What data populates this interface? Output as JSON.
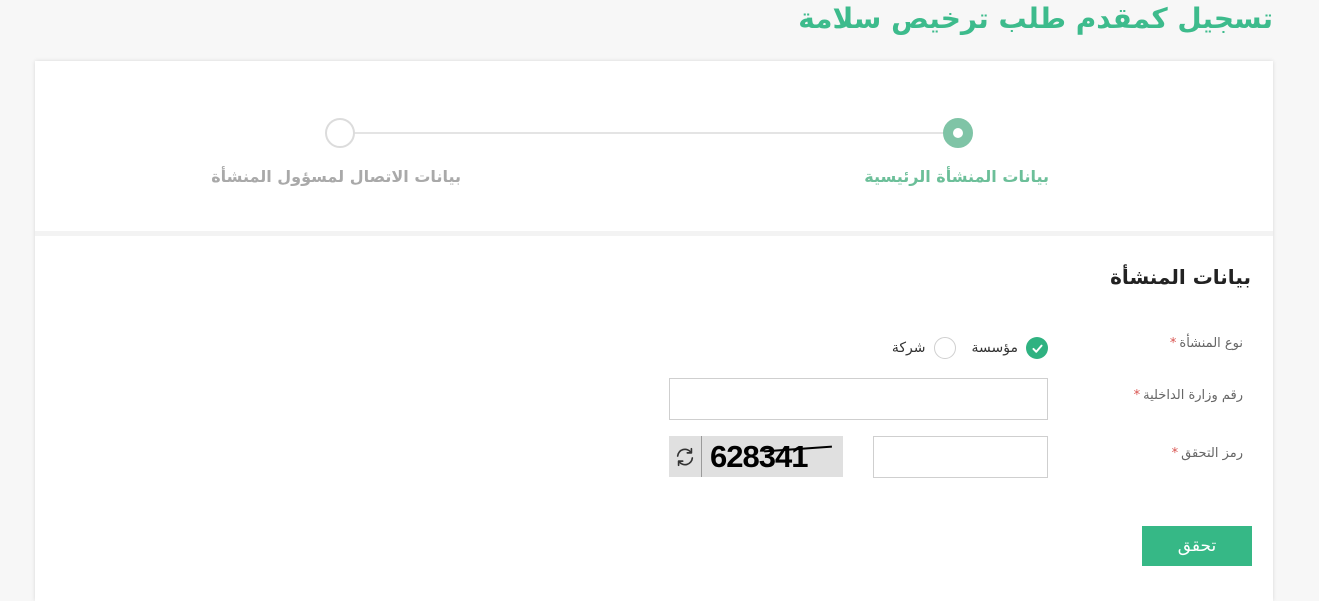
{
  "page": {
    "title": "تسجيل كمقدم طلب ترخيص سلامة"
  },
  "stepper": {
    "steps": [
      {
        "label": "بيانات المنشأة الرئيسية",
        "state": "active"
      },
      {
        "label": "بيانات الاتصال لمسؤول المنشأة",
        "state": "inactive"
      }
    ]
  },
  "form": {
    "section_title": "بيانات المنشأة",
    "required_mark": "*",
    "facility_type": {
      "label": "نوع المنشأة",
      "options": [
        {
          "label": "مؤسسة",
          "checked": true
        },
        {
          "label": "شركة",
          "checked": false
        }
      ]
    },
    "moi_number": {
      "label": "رقم وزارة الداخلية",
      "value": ""
    },
    "captcha": {
      "label": "رمز التحقق",
      "value": "",
      "code": "628341"
    },
    "submit_label": "تحقق"
  },
  "colors": {
    "accent": "#36b886",
    "required": "#d9534f",
    "step_active": "#7fc4a6"
  }
}
